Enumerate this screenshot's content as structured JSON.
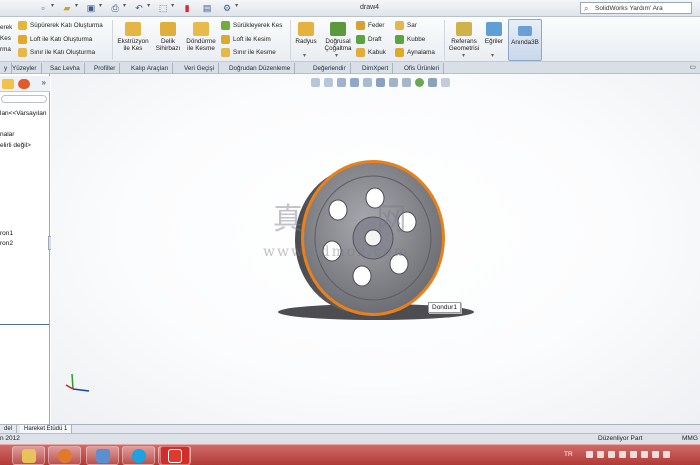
{
  "window": {
    "title": "draw4",
    "help_search": "SolidWorks Yardım' Ara"
  },
  "ribbon": {
    "left_labels": [
      "erek",
      "Kes",
      "rma"
    ],
    "sweep_boss": "Süpürerek Katı Oluşturma",
    "loft_boss": "Loft ile Katı Oluşturma",
    "boundary_boss": "Sınır ile Katı Oluşturma",
    "extrude_cut": [
      "Ekstrüzyon",
      "ile Kes"
    ],
    "hole_wizard": [
      "Delik",
      "Sihirbazı"
    ],
    "revolve_cut": [
      "Döndürme",
      "ile Kesme"
    ],
    "sweep_cut": "Sürükleyerek Kes",
    "loft_cut": "Loft ile Kesim",
    "boundary_cut": "Sınır ile Kesme",
    "fillet": "Radyus",
    "linear_pattern": [
      "Doğrusal",
      "Çoğaltma"
    ],
    "rib": "Feder",
    "wrap": "Sar",
    "draft": "Draft",
    "dome": "Kubbe",
    "shell": "Kabuk",
    "mirror": "Aynalama",
    "ref_geometry": [
      "Referans",
      "Geometrisi"
    ],
    "curves": "Eğriler",
    "instant3d": "Anında3B"
  },
  "tabs": [
    "y",
    "Yüzeyler",
    "Sac Levha",
    "Profiller",
    "Kalıp Araçları",
    "Veri Geçişi",
    "Doğrudan Düzenleme",
    "Değerlendir",
    "DimXpert",
    "Ofis Ürünleri"
  ],
  "tree": {
    "item1": "lan<<Varsayılan",
    "item2": "nalar",
    "item3": "elirli değil>",
    "item4": "ron1",
    "item5": "ron2"
  },
  "tooltip": "Dondur1",
  "watermark": {
    "big": "真 网",
    "small": "www.3dmox.com"
  },
  "bottom_tabs": [
    "del",
    "Hareket Etüdü 1"
  ],
  "status": {
    "left": "n 2012",
    "mode": "Düzenliyor Part",
    "right": "MMG"
  },
  "tray": {
    "lang": "TR"
  },
  "icons": [
    "search-icon",
    "sweep-icon",
    "loft-icon",
    "boundary-icon",
    "extrude-cut-icon",
    "hole-wizard-icon",
    "revolve-cut-icon",
    "fillet-icon",
    "pattern-icon",
    "rib-icon",
    "wrap-icon",
    "draft-icon",
    "dome-icon",
    "shell-icon",
    "mirror-icon",
    "ref-geometry-icon",
    "curves-icon",
    "instant3d-icon",
    "explorer-icon",
    "firefox-icon",
    "network-icon",
    "skype-icon",
    "chrome-icon",
    "solidworks-icon"
  ],
  "colors": {
    "taskbar": "#b13a36",
    "accent": "#e8801c",
    "part_gray": "#7f7f84"
  }
}
